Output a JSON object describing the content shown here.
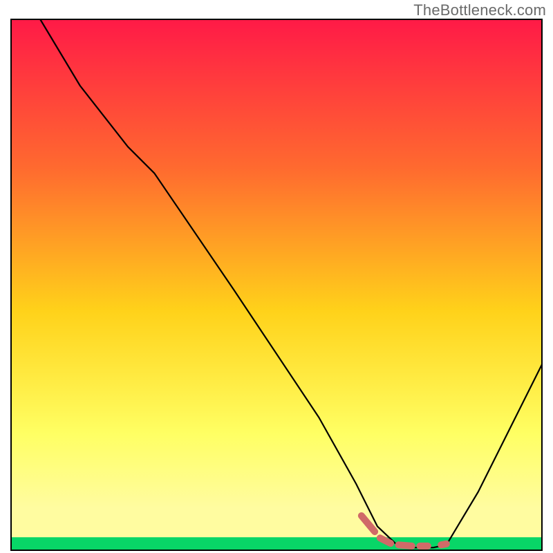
{
  "attribution": "TheBottleneck.com",
  "chart_data": {
    "type": "line",
    "title": "",
    "xlabel": "",
    "ylabel": "",
    "xlim": [
      0,
      100
    ],
    "ylim": [
      0,
      100
    ],
    "grid": false,
    "legend": false,
    "background_gradient": {
      "top": "#ff1a47",
      "mid_upper": "#ff6a2f",
      "mid": "#ffd21a",
      "mid_lower": "#ffff63",
      "band_yellow": "#fffca0",
      "bottom": "#08d667"
    },
    "series": [
      {
        "name": "curve",
        "points": [
          {
            "x": 5.5,
            "y": 100.0
          },
          {
            "x": 13.0,
            "y": 87.5
          },
          {
            "x": 22.0,
            "y": 76.0
          },
          {
            "x": 27.0,
            "y": 71.0
          },
          {
            "x": 42.0,
            "y": 49.0
          },
          {
            "x": 58.0,
            "y": 25.0
          },
          {
            "x": 65.0,
            "y": 12.5
          },
          {
            "x": 69.0,
            "y": 4.5
          },
          {
            "x": 72.5,
            "y": 1.2
          },
          {
            "x": 76.0,
            "y": 0.5
          },
          {
            "x": 79.5,
            "y": 0.5
          },
          {
            "x": 82.0,
            "y": 1.0
          },
          {
            "x": 88.0,
            "y": 11.0
          },
          {
            "x": 94.0,
            "y": 23.0
          },
          {
            "x": 100.0,
            "y": 35.0
          }
        ]
      }
    ],
    "dashed_highlight": {
      "color": "#d06a68",
      "segments": [
        {
          "x1": 66.0,
          "y1": 6.5,
          "x2": 68.5,
          "y2": 3.5
        },
        {
          "x1": 69.5,
          "y1": 2.3,
          "x2": 71.5,
          "y2": 1.3
        },
        {
          "x1": 73.0,
          "y1": 1.0,
          "x2": 75.5,
          "y2": 0.8
        },
        {
          "x1": 77.0,
          "y1": 0.8,
          "x2": 78.5,
          "y2": 0.8
        },
        {
          "x1": 81.0,
          "y1": 1.0,
          "x2": 82.0,
          "y2": 1.2
        }
      ]
    }
  }
}
